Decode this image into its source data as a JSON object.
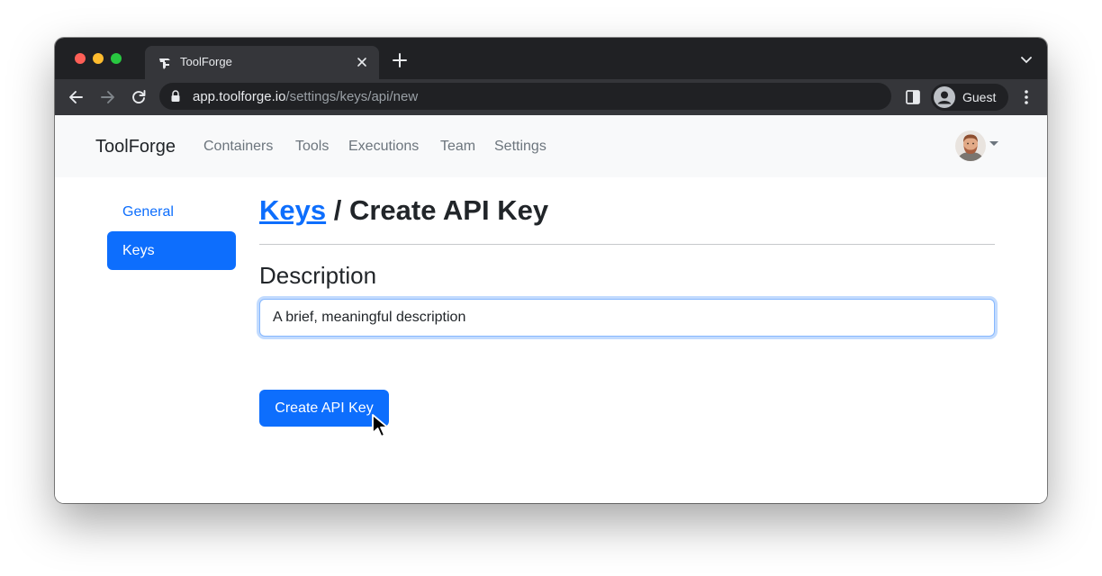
{
  "browser": {
    "tab_title": "ToolForge",
    "url_host": "app.toolforge.io",
    "url_path": "/settings/keys/api/new",
    "profile_label": "Guest"
  },
  "navbar": {
    "brand": "ToolForge",
    "links": [
      "Containers",
      "Tools",
      "Executions",
      "Team",
      "Settings"
    ]
  },
  "sidebar": {
    "items": [
      {
        "label": "General",
        "active": false
      },
      {
        "label": "Keys",
        "active": true
      }
    ]
  },
  "main": {
    "breadcrumb_link": "Keys",
    "breadcrumb_separator": " / ",
    "title": "Create API Key",
    "field_label": "Description",
    "input_value": "A brief, meaningful description",
    "submit_label": "Create API Key"
  },
  "colors": {
    "primary": "#0d6efd",
    "navbar_bg": "#f8f9fa",
    "chrome_dark": "#202124",
    "chrome_toolbar": "#35363a"
  },
  "icons": {
    "tab_favicon": "toolforge-logo-icon",
    "back": "arrow-left-icon",
    "forward": "arrow-right-icon",
    "reload": "reload-icon",
    "lock": "lock-icon",
    "side_panel": "side-panel-icon",
    "profile": "person-circle-icon",
    "menu": "kebab-menu-icon"
  }
}
